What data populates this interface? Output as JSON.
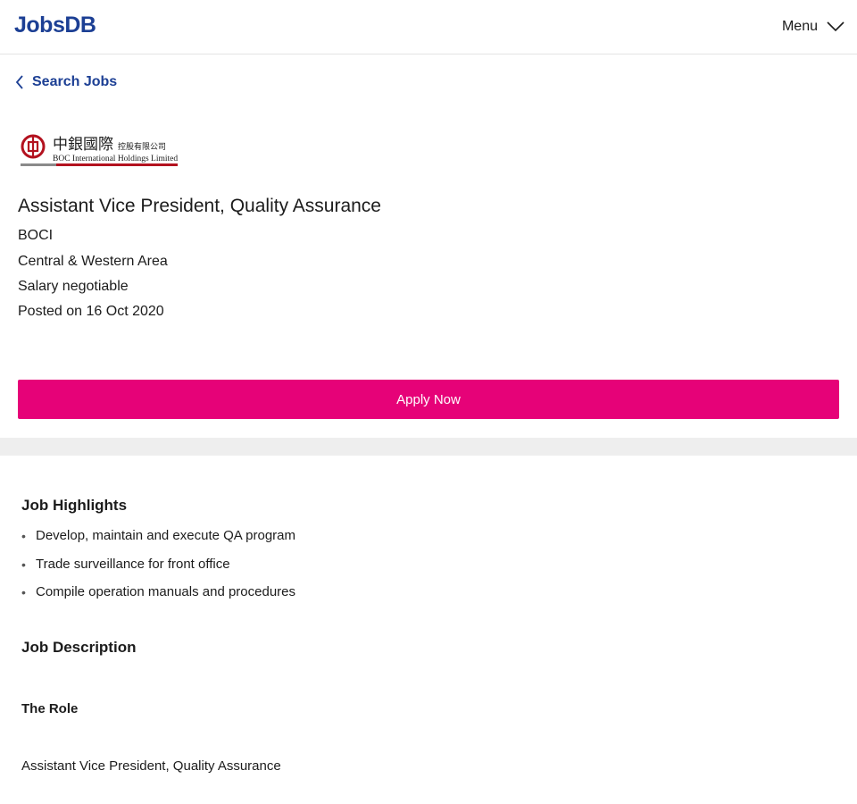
{
  "header": {
    "logo_text": "JobsDB",
    "menu_label": "Menu"
  },
  "nav": {
    "back_label": "Search Jobs"
  },
  "company_logo": {
    "chinese_name": "中銀國際",
    "chinese_sub": "控股有限公司",
    "english_name": "BOC International Holdings Limited",
    "brand_color": "#b3121f"
  },
  "job": {
    "title": "Assistant Vice President, Quality Assurance",
    "company": "BOCI",
    "location": "Central & Western Area",
    "salary": "Salary negotiable",
    "posted": "Posted on 16 Oct 2020"
  },
  "actions": {
    "apply_label": "Apply Now"
  },
  "highlights": {
    "title": "Job Highlights",
    "items": [
      "Develop, maintain and execute QA program",
      "Trade surveillance for front office",
      "Compile operation manuals and procedures"
    ]
  },
  "description": {
    "title": "Job Description",
    "role_heading": "The Role",
    "role_text": "Assistant Vice President, Quality Assurance"
  },
  "colors": {
    "brand_blue": "#1c3f94",
    "apply_pink": "#e60278"
  }
}
